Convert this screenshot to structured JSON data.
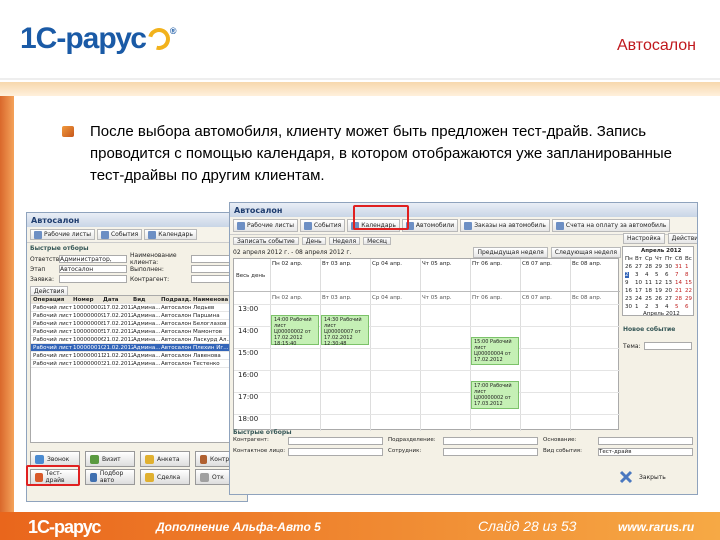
{
  "header": {
    "logo": "1С-рарус",
    "logo_reg": "®",
    "title": "Автосалон"
  },
  "body": {
    "text": "После выбора автомобиля, клиенту может быть предложен тест-драйв. Запись проводится с помощью календаря, в котором отображаются уже запланированные тест-драйвы по другим клиентам."
  },
  "footer": {
    "logo": "1С-рарус",
    "product": "Дополнение Альфа-Авто 5",
    "slide": "Слайд 28 из 53",
    "url": "www.rarus.ru"
  },
  "back_window": {
    "title": "Автосалон",
    "tabs": [
      "Рабочие листы",
      "События",
      "Календарь"
    ],
    "quick_filters_label": "Быстрые отборы",
    "filters": [
      {
        "label": "Ответств.",
        "value": "Администратор, неограниченный",
        "label2": "Наименование клиента:"
      },
      {
        "label": "Этап",
        "value": "Автосалон",
        "label2": "Выполнен:"
      },
      {
        "label": "Заявка:",
        "value": "",
        "label2": "Контрагент:"
      }
    ],
    "actions_label": "Действия",
    "columns": [
      "Операция",
      "Номер",
      "Дата",
      "Вид",
      "Подразд.",
      "Наименова"
    ],
    "rows": [
      [
        "Рабочий лист",
        "100000002",
        "17.02.2012",
        "Админа...",
        "Автосалон",
        "Ледьев"
      ],
      [
        "Рабочий лист",
        "100000009",
        "17.02.2012",
        "Админа...",
        "Автосалон",
        "Паршина"
      ],
      [
        "Рабочий лист",
        "100000008",
        "17.02.2012",
        "Админа...",
        "Автосалон",
        "Белоглазов"
      ],
      [
        "Рабочий лист",
        "100000005",
        "17.02.2012",
        "Админа...",
        "Автосалон",
        "Мамонтов"
      ],
      [
        "Рабочий лист",
        "100000006",
        "21.02.2012",
        "Админа...",
        "Автосалон",
        "Ласкурд Ал..."
      ],
      [
        "Рабочий лист",
        "100000010",
        "21.02.2012",
        "Админа...",
        "Автосалон",
        "Плехин Иг..."
      ],
      [
        "Рабочий лист",
        "100000011",
        "21.02.2012",
        "Админа...",
        "Автосалон",
        "Лавенова"
      ],
      [
        "Рабочий лист",
        "100000003",
        "21.02.2012",
        "Админа...",
        "Автосалон",
        "Тестенко"
      ]
    ],
    "buttons": [
      "Звонок",
      "Визит",
      "Анкета",
      "Контракт",
      "Тест-драйв",
      "Подбор авто",
      "Сделка",
      "Отк"
    ]
  },
  "front_window": {
    "title": "Автосалон",
    "tabs": [
      "Рабочие листы",
      "События",
      "Календарь",
      "Автомобили",
      "Заказы на автомобиль",
      "Счета на оплату за автомобиль"
    ],
    "toolbar": [
      "Записать событие",
      "День",
      "Неделя",
      "Месяц"
    ],
    "period": "02 апреля 2012 г. - 08 апреля 2012 г.",
    "prev": "Предыдущая неделя",
    "next": "Следующая неделя",
    "settings": "Настройка",
    "actions": "Действия",
    "allday": "Весь день",
    "days": [
      "Пн 02 апр.",
      "Вт 03 апр.",
      "Ср 04 апр.",
      "Чт 05 апр.",
      "Пт 06 апр.",
      "Сб 07 апр.",
      "Вс 08 апр."
    ],
    "times": [
      "13:00",
      "14:00",
      "15:00",
      "16:00",
      "17:00",
      "18:00"
    ],
    "appointments": [
      {
        "text": "14:00 Рабочий лист Ц00000002 от 17.02.2012 18:15:40"
      },
      {
        "text": "14:30 Рабочий лист Ц00000007 от 17.02.2012 12:30:48"
      },
      {
        "text": "15:00 Рабочий лист Ц00000004 от 17.02.2012"
      },
      {
        "text": "17:00 Рабочий лист Ц00000002 от 17.03.2012"
      }
    ],
    "quick_filters_label": "Быстрые отборы",
    "filters": [
      "Контрагент:",
      "Подразделение:",
      "Основание:",
      "Контактное лицо:",
      "Сотрудник:",
      "Вид события:"
    ],
    "filter_value": "Тест-драйв",
    "new_event_label": "Новое событие",
    "theme_label": "Тема:",
    "close_label": "Закрыть",
    "mini_cal": {
      "month": "Апрель 2012",
      "week": [
        "Пн",
        "Вт",
        "Ср",
        "Чт",
        "Пт",
        "Сб",
        "Вс"
      ],
      "rows": [
        [
          "26",
          "27",
          "28",
          "29",
          "30",
          "31",
          "1"
        ],
        [
          "2",
          "3",
          "4",
          "5",
          "6",
          "7",
          "8"
        ],
        [
          "9",
          "10",
          "11",
          "12",
          "13",
          "14",
          "15"
        ],
        [
          "16",
          "17",
          "18",
          "19",
          "20",
          "21",
          "22"
        ],
        [
          "23",
          "24",
          "25",
          "26",
          "27",
          "28",
          "29"
        ],
        [
          "30",
          "1",
          "2",
          "3",
          "4",
          "5",
          "6"
        ]
      ],
      "footer": "Апрель 2012"
    }
  }
}
